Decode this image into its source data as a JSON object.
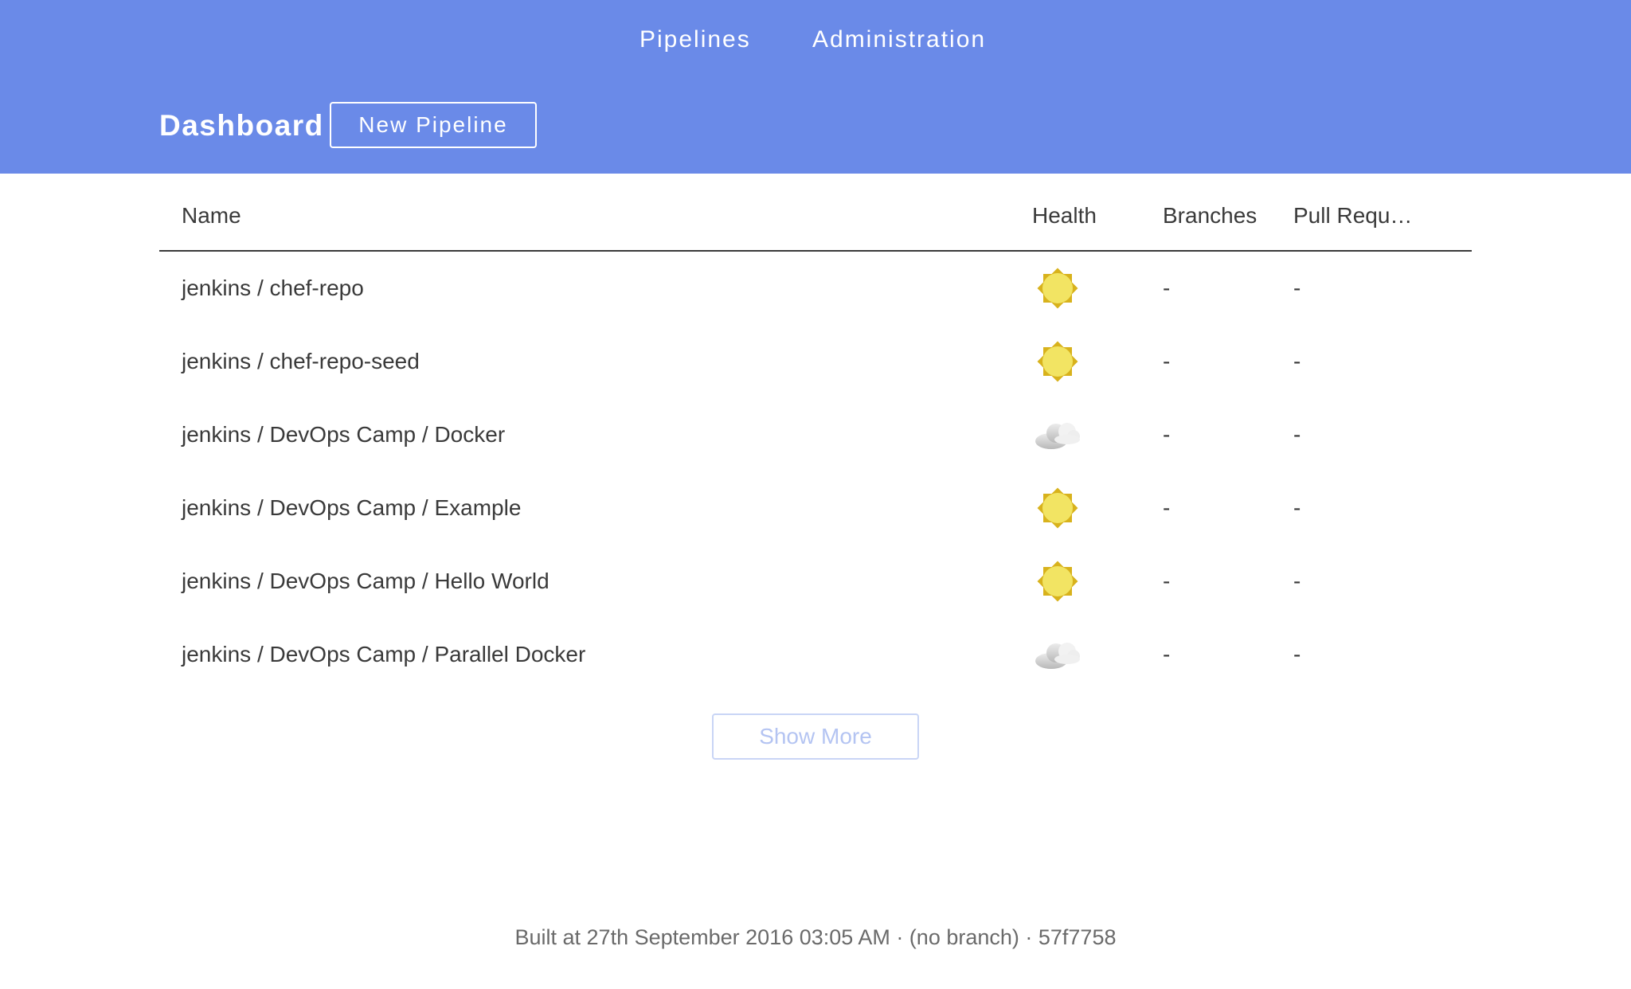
{
  "nav": {
    "pipelines": "Pipelines",
    "administration": "Administration"
  },
  "header": {
    "title": "Dashboard",
    "new_pipeline_label": "New Pipeline"
  },
  "table": {
    "columns": [
      "Name",
      "Health",
      "Branches",
      "Pull Requ…"
    ],
    "rows": [
      {
        "name": "jenkins / chef-repo",
        "health": "sunny-icon",
        "branches": "-",
        "pull_requests": "-"
      },
      {
        "name": "jenkins / chef-repo-seed",
        "health": "sunny-icon",
        "branches": "-",
        "pull_requests": "-"
      },
      {
        "name": "jenkins / DevOps Camp / Docker",
        "health": "cloudy-icon",
        "branches": "-",
        "pull_requests": "-"
      },
      {
        "name": "jenkins / DevOps Camp / Example",
        "health": "sunny-icon",
        "branches": "-",
        "pull_requests": "-"
      },
      {
        "name": "jenkins / DevOps Camp / Hello World",
        "health": "sunny-icon",
        "branches": "-",
        "pull_requests": "-"
      },
      {
        "name": "jenkins / DevOps Camp / Parallel Docker",
        "health": "cloudy-icon",
        "branches": "-",
        "pull_requests": "-"
      }
    ],
    "show_more_label": "Show More"
  },
  "footer": {
    "build_info": "Built at 27th September 2016 03:05 AM · (no branch) · 57f7758"
  },
  "colors": {
    "header_bg": "#6a8ae8",
    "sun_fill": "#f2e463",
    "sun_rays": "#d8b21c",
    "cloud_light": "#ececec",
    "cloud_dark": "#b8b8b8"
  }
}
